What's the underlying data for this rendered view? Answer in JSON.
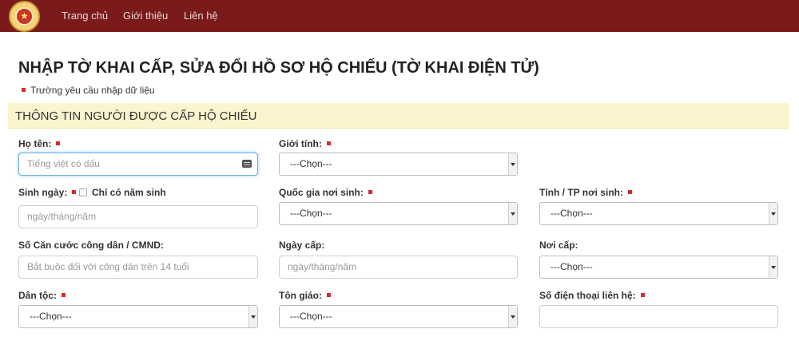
{
  "navbar": {
    "items": [
      "Trang chủ",
      "Giới thiệu",
      "Liên hệ"
    ],
    "logo_icon": "emblem-icon",
    "color": "#7a1a1a"
  },
  "page": {
    "title": "NHẬP TỜ KHAI CẤP, SỬA ĐỔI HỒ SƠ HỘ CHIẾU (TỜ KHAI ĐIỆN TỬ)",
    "required_note": "Trường yêu cầu nhập dữ liệu"
  },
  "section": {
    "title": "THÔNG TIN NGƯỜI ĐƯỢC CẤP HỘ CHIẾU",
    "background": "#fcf4cf"
  },
  "fields": {
    "ho_ten": {
      "label": "Họ tên:",
      "placeholder": "Tiếng việt có dấu"
    },
    "gioi_tinh": {
      "label": "Giới tính:",
      "value": "---Chọn---"
    },
    "sinh_ngay": {
      "label": "Sinh ngày:",
      "checkbox_label": "Chỉ có năm sinh",
      "placeholder": "ngày/tháng/năm"
    },
    "quoc_gia": {
      "label": "Quốc gia nơi sinh:",
      "value": "---Chọn---"
    },
    "tinh_tp": {
      "label": "Tỉnh / TP nơi sinh:",
      "value": "---Chọn---"
    },
    "cccd": {
      "label": "Số Căn cước công dân / CMND:",
      "placeholder": "Bắt buộc đối với công dân trên 14 tuổi"
    },
    "ngay_cap": {
      "label": "Ngày cấp:",
      "placeholder": "ngày/tháng/năm"
    },
    "noi_cap": {
      "label": "Nơi cấp:",
      "value": "---Chọn---"
    },
    "dan_toc": {
      "label": "Dân tộc:",
      "value": "---Chọn---"
    },
    "ton_giao": {
      "label": "Tôn giáo:",
      "value": "---Chọn---"
    },
    "so_dien_thoai": {
      "label": "Số điện thoại liên hệ:",
      "placeholder": ""
    }
  },
  "colors": {
    "required_marker": "#d52b2b",
    "focus_border": "#66afe9"
  }
}
